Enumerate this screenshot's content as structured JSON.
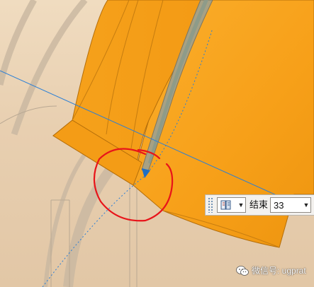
{
  "toolbar": {
    "selector_icon": "book-icon",
    "end_label": "结束",
    "end_value": "33"
  },
  "watermark": {
    "icon": "wechat-icon",
    "text": "微信号: ugprat"
  },
  "colors": {
    "background": "#e7cfae",
    "model_orange": "#f7a019",
    "model_orange_dark": "#e08f10",
    "groove_gray": "#9e9a7c",
    "highlight_circle": "#e8141a",
    "axis_blue": "#2a7fd6",
    "ghost_geometry": "#cdbca6"
  }
}
